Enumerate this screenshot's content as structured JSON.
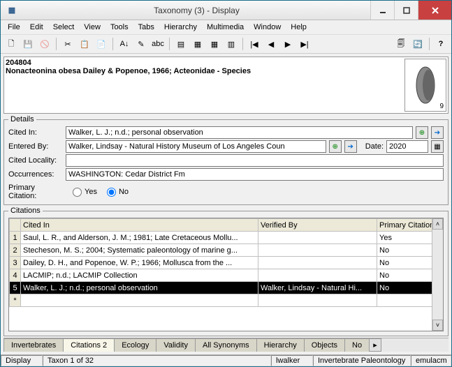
{
  "window": {
    "title": "Taxonomy (3) - Display"
  },
  "menu": [
    "File",
    "Edit",
    "Select",
    "View",
    "Tools",
    "Tabs",
    "Hierarchy",
    "Multimedia",
    "Window",
    "Help"
  ],
  "header": {
    "id": "204804",
    "name": "Nonacteonina obesa Dailey & Popenoe, 1966; Acteonidae - Species",
    "thumb_num": "9"
  },
  "details": {
    "legend": "Details",
    "labels": {
      "cited_in": "Cited In:",
      "entered_by": "Entered By:",
      "date": "Date:",
      "cited_locality": "Cited Locality:",
      "occurrences": "Occurrences:",
      "primary": "Primary Citation:",
      "yes": "Yes",
      "no": "No"
    },
    "values": {
      "cited_in": "Walker, L. J.; n.d.; personal observation",
      "entered_by": "Walker, Lindsay - Natural History Museum of Los Angeles Coun",
      "date": "2020",
      "cited_locality": "",
      "occurrences": "WASHINGTON: Cedar District Fm"
    },
    "primary_selected": "no"
  },
  "citations": {
    "legend": "Citations",
    "columns": [
      "Cited In",
      "Verified By",
      "Primary Citation"
    ],
    "rows": [
      {
        "n": "1",
        "cited": "Saul, L. R., and Alderson, J. M.; 1981; Late Cretaceous Mollu...",
        "ver": "",
        "pc": "Yes"
      },
      {
        "n": "2",
        "cited": "Stecheson, M. S.; 2004; Systematic paleontology of marine g...",
        "ver": "",
        "pc": "No"
      },
      {
        "n": "3",
        "cited": "Dailey, D. H., and Popenoe, W. P.; 1966; Mollusca from the ...",
        "ver": "",
        "pc": "No"
      },
      {
        "n": "4",
        "cited": "LACMIP; n.d.; LACMIP Collection",
        "ver": "",
        "pc": "No"
      },
      {
        "n": "5",
        "cited": "Walker, L. J.; n.d.; personal observation",
        "ver": "Walker, Lindsay - Natural Hi...",
        "pc": "No",
        "selected": true
      }
    ]
  },
  "tabs": [
    "Invertebrates",
    "Citations 2",
    "Ecology",
    "Validity",
    "All Synonyms",
    "Hierarchy",
    "Objects",
    "No"
  ],
  "active_tab": 1,
  "status": {
    "mode": "Display",
    "count": "Taxon 1 of 32",
    "user": "lwalker",
    "dept": "Invertebrate Paleontology",
    "db": "emulacm"
  }
}
